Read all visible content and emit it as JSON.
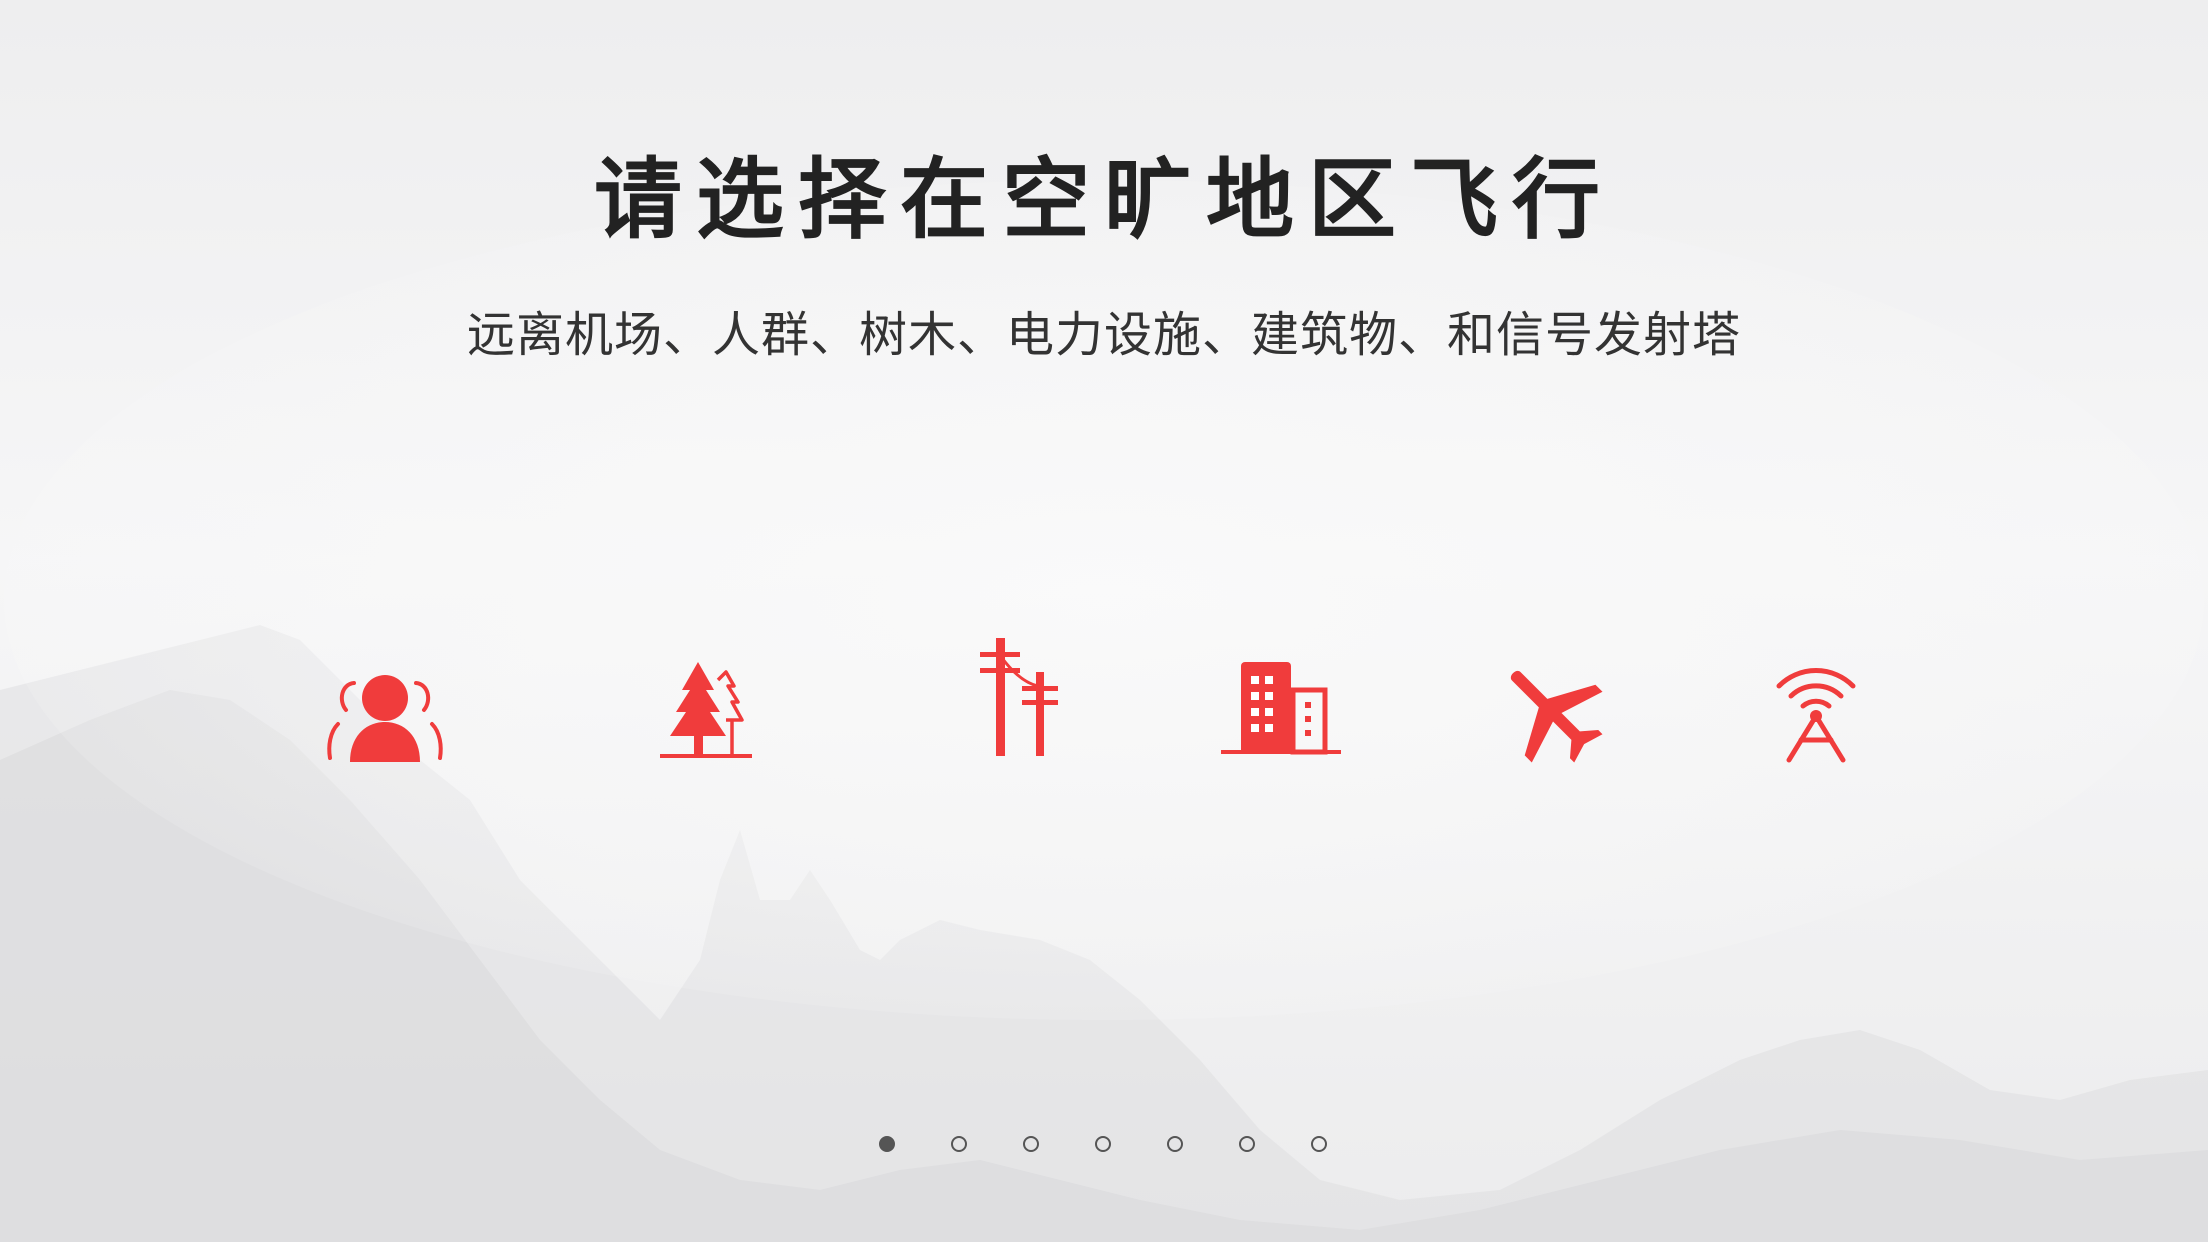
{
  "title": "请选择在空旷地区飞行",
  "subtitle": "远离机场、人群、树木、电力设施、建筑物、和信号发射塔",
  "colors": {
    "accent": "#f03c3c",
    "text_dark": "#222222",
    "text_body": "#333333",
    "dot": "#555555",
    "background": "#f3f3f4"
  },
  "icons": [
    {
      "name": "crowd-icon"
    },
    {
      "name": "trees-icon"
    },
    {
      "name": "power-line-icon"
    },
    {
      "name": "building-icon"
    },
    {
      "name": "airplane-icon"
    },
    {
      "name": "signal-tower-icon"
    }
  ],
  "pagination": {
    "total": 7,
    "active_index": 0
  }
}
